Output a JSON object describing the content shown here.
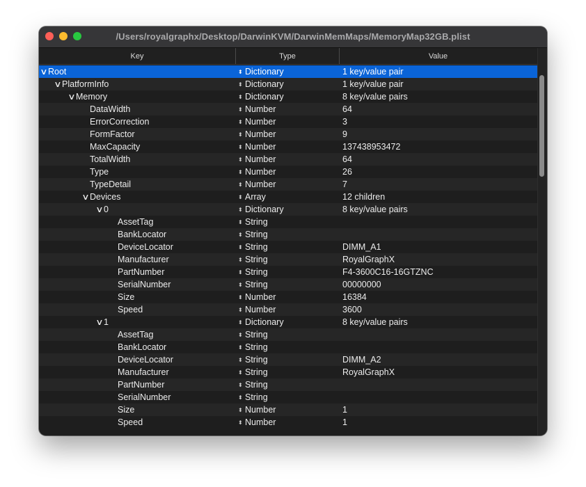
{
  "window": {
    "title": "/Users/royalgraphx/Desktop/DarwinKVM/DarwinMemMaps/MemoryMap32GB.plist"
  },
  "columns": {
    "key": "Key",
    "type": "Type",
    "value": "Value"
  },
  "icons": {
    "expanded": "chevron-down-icon",
    "type_stepper": "up-down-stepper-icon"
  },
  "colors": {
    "selection": "#0a64d8",
    "close": "#fe5f57",
    "minimize": "#febc2e",
    "zoom": "#28c840"
  },
  "rows": [
    {
      "key": "Root",
      "level": 0,
      "expanded": true,
      "type": "Dictionary",
      "value": "1 key/value pair",
      "selected": true
    },
    {
      "key": "PlatformInfo",
      "level": 1,
      "expanded": true,
      "type": "Dictionary",
      "value": "1 key/value pair"
    },
    {
      "key": "Memory",
      "level": 2,
      "expanded": true,
      "type": "Dictionary",
      "value": "8 key/value pairs"
    },
    {
      "key": "DataWidth",
      "level": 3,
      "type": "Number",
      "value": "64"
    },
    {
      "key": "ErrorCorrection",
      "level": 3,
      "type": "Number",
      "value": "3"
    },
    {
      "key": "FormFactor",
      "level": 3,
      "type": "Number",
      "value": "9"
    },
    {
      "key": "MaxCapacity",
      "level": 3,
      "type": "Number",
      "value": "137438953472"
    },
    {
      "key": "TotalWidth",
      "level": 3,
      "type": "Number",
      "value": "64"
    },
    {
      "key": "Type",
      "level": 3,
      "type": "Number",
      "value": "26"
    },
    {
      "key": "TypeDetail",
      "level": 3,
      "type": "Number",
      "value": "7"
    },
    {
      "key": "Devices",
      "level": 3,
      "expanded": true,
      "type": "Array",
      "value": "12 children"
    },
    {
      "key": "0",
      "level": 4,
      "expanded": true,
      "type": "Dictionary",
      "value": "8 key/value pairs"
    },
    {
      "key": "AssetTag",
      "level": 5,
      "type": "String",
      "value": ""
    },
    {
      "key": "BankLocator",
      "level": 5,
      "type": "String",
      "value": ""
    },
    {
      "key": "DeviceLocator",
      "level": 5,
      "type": "String",
      "value": "DIMM_A1"
    },
    {
      "key": "Manufacturer",
      "level": 5,
      "type": "String",
      "value": "RoyalGraphX"
    },
    {
      "key": "PartNumber",
      "level": 5,
      "type": "String",
      "value": "F4-3600C16-16GTZNC"
    },
    {
      "key": "SerialNumber",
      "level": 5,
      "type": "String",
      "value": "00000000"
    },
    {
      "key": "Size",
      "level": 5,
      "type": "Number",
      "value": "16384"
    },
    {
      "key": "Speed",
      "level": 5,
      "type": "Number",
      "value": "3600"
    },
    {
      "key": "1",
      "level": 4,
      "expanded": true,
      "type": "Dictionary",
      "value": "8 key/value pairs"
    },
    {
      "key": "AssetTag",
      "level": 5,
      "type": "String",
      "value": ""
    },
    {
      "key": "BankLocator",
      "level": 5,
      "type": "String",
      "value": ""
    },
    {
      "key": "DeviceLocator",
      "level": 5,
      "type": "String",
      "value": "DIMM_A2"
    },
    {
      "key": "Manufacturer",
      "level": 5,
      "type": "String",
      "value": "RoyalGraphX"
    },
    {
      "key": "PartNumber",
      "level": 5,
      "type": "String",
      "value": ""
    },
    {
      "key": "SerialNumber",
      "level": 5,
      "type": "String",
      "value": ""
    },
    {
      "key": "Size",
      "level": 5,
      "type": "Number",
      "value": "1"
    },
    {
      "key": "Speed",
      "level": 5,
      "type": "Number",
      "value": "1"
    }
  ]
}
